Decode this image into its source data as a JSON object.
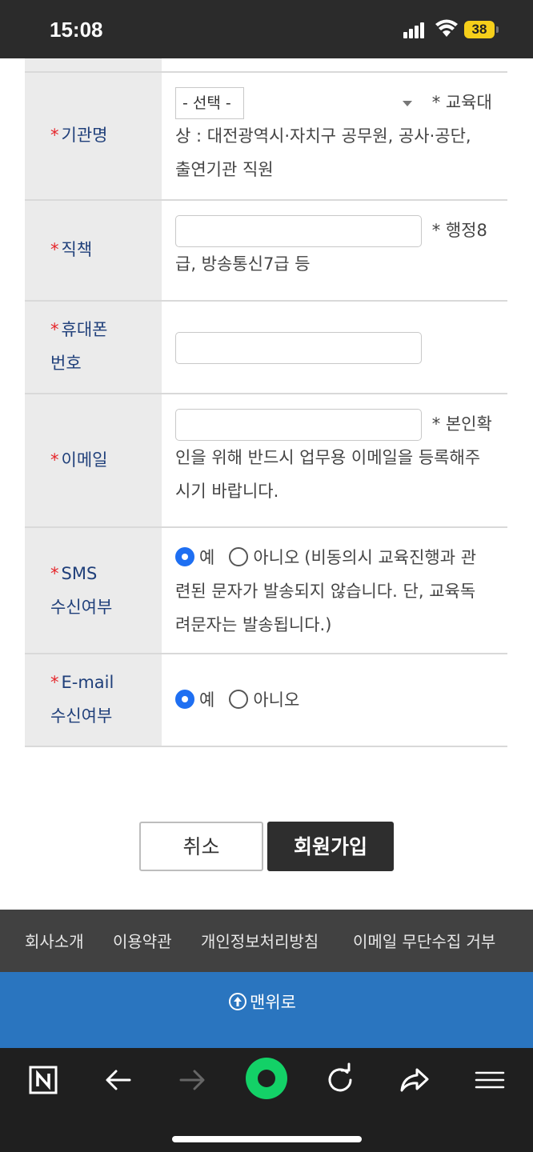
{
  "status": {
    "time": "15:08",
    "battery": "38"
  },
  "form": {
    "required_mark": "*",
    "rows": [
      {
        "label": "기관명",
        "select_value": "- 선택 -",
        "hint": "* 교육대상 : 대전광역시·자치구 공무원, 공사·공단, 출연기관 직원",
        "hint_first": "* 교육대",
        "hint_rest": "상 : 대전광역시·자치구 공무원, 공사·공단,",
        "hint_rest2": "출연기관 직원"
      },
      {
        "label": "직책",
        "input_value": "",
        "hint_first": "* 행정8",
        "hint_rest": "급, 방송통신7급 등"
      },
      {
        "label_line1": "휴대폰",
        "label_line2": "번호",
        "input_value": ""
      },
      {
        "label": "이메일",
        "input_value": "",
        "hint_first": "* 본인확",
        "hint_rest": "인을 위해 반드시 업무용 이메일을 등록해주",
        "hint_rest2": "시기 바랍니다."
      },
      {
        "label_line1": "SMS",
        "label_line2": "수신여부",
        "yes": "예",
        "no": "아니오",
        "selected": "예",
        "note_first": "(비동의시 교육진행과 관",
        "note_rest": "련된 문자가 발송되지 않습니다. 단, 교육독",
        "note_rest2": "려문자는 발송됩니다.)"
      },
      {
        "label_line1": "E-mail",
        "label_line2": "수신여부",
        "yes": "예",
        "no": "아니오",
        "selected": "예"
      }
    ]
  },
  "buttons": {
    "cancel": "취소",
    "submit": "회원가입"
  },
  "footer": {
    "links": [
      "회사소개",
      "이용약관",
      "개인정보처리방침",
      "이메일 무단수집 거부"
    ],
    "to_top": "맨위로"
  },
  "browser": {
    "icons": [
      "naver-home-icon",
      "back-icon",
      "forward-icon",
      "green-dot-icon",
      "refresh-icon",
      "share-icon",
      "menu-icon"
    ]
  }
}
